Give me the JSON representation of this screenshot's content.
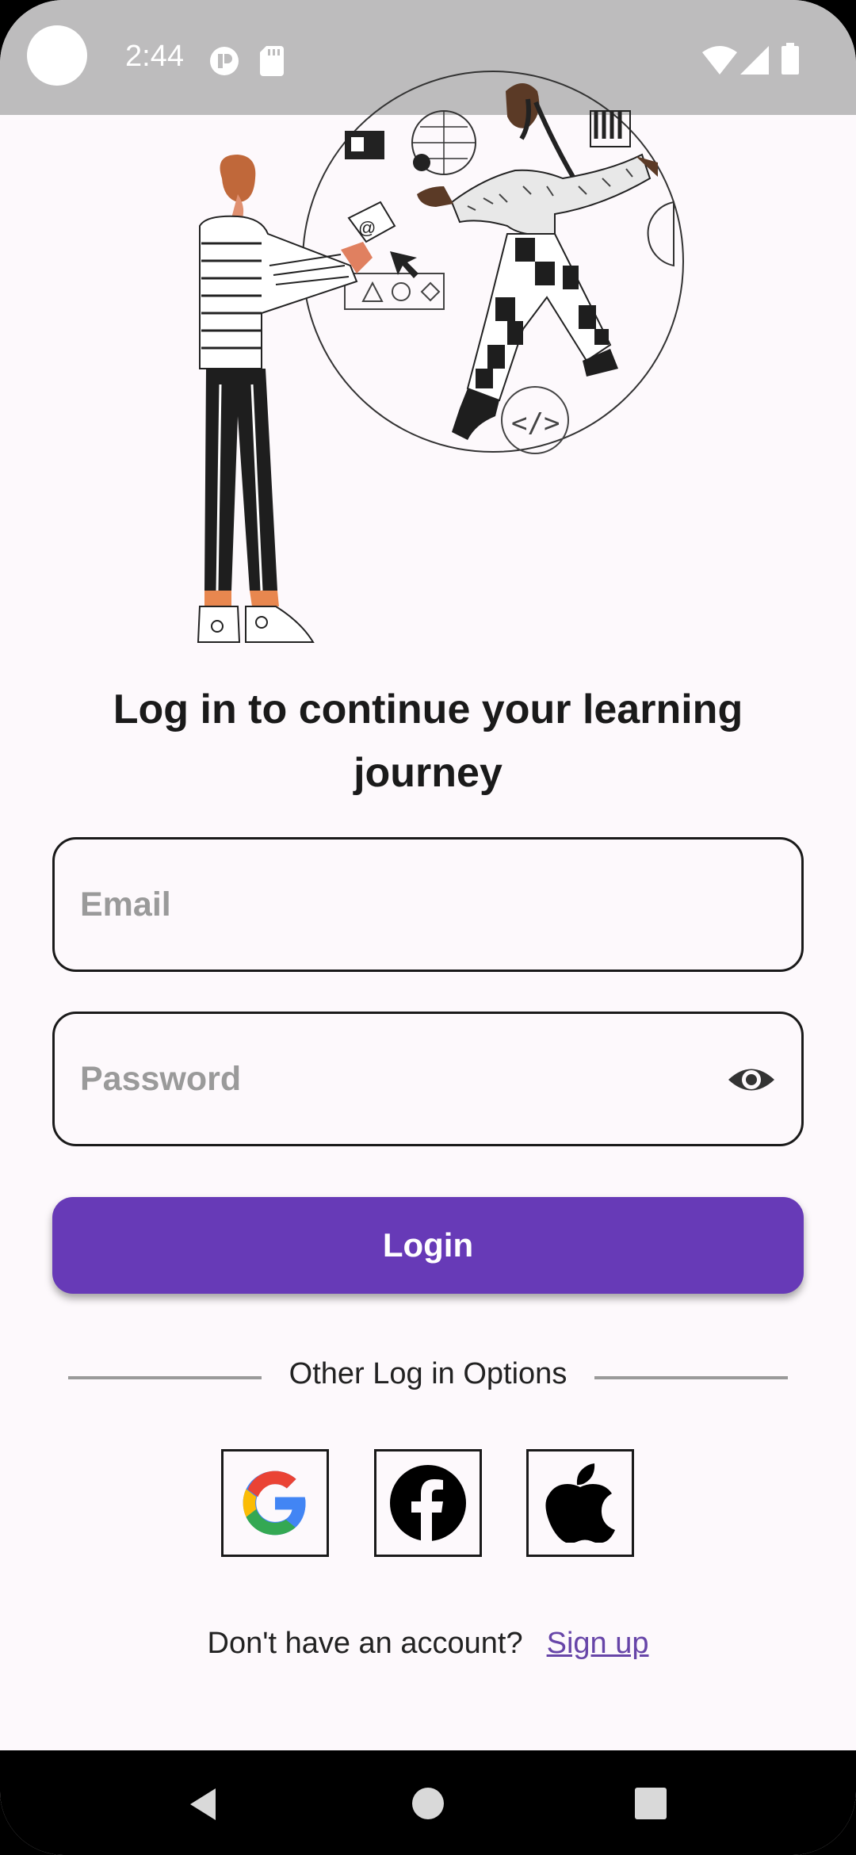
{
  "status_bar": {
    "time": "2:44",
    "icons": [
      "notification-icon",
      "sd-card-icon",
      "wifi-icon",
      "signal-icon",
      "battery-icon"
    ]
  },
  "illustration": {
    "icon": "people-learning-illustration"
  },
  "login": {
    "heading": "Log in to continue your learning journey",
    "email_placeholder": "Email",
    "password_placeholder": "Password",
    "login_button": "Login",
    "other_options": "Other Log in Options",
    "social_buttons": [
      "google-icon",
      "facebook-icon",
      "apple-icon"
    ],
    "no_account_text": "Don't have an account?",
    "signup_link": "Sign up"
  },
  "colors": {
    "accent": "#673ab7",
    "link": "#6745a8",
    "background": "#fdf9fc",
    "status_bar": "#bdbcbd"
  },
  "nav_bar": {
    "icons": [
      "back-icon",
      "home-icon",
      "recents-icon"
    ]
  }
}
